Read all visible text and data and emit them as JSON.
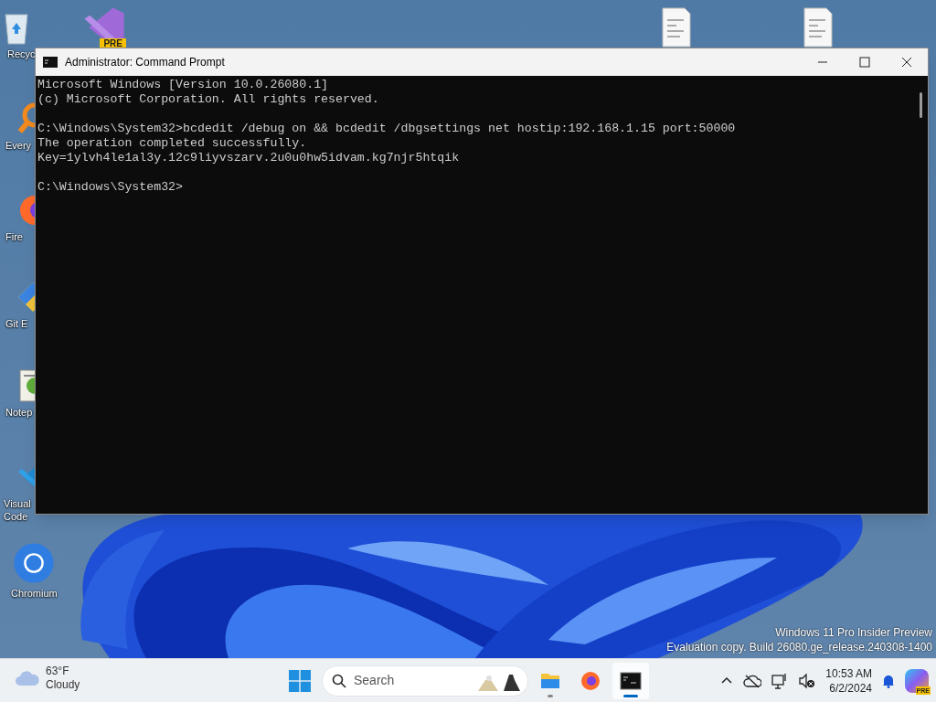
{
  "desktop": {
    "icons": [
      {
        "kind": "recycle",
        "label": "Recyc"
      },
      {
        "kind": "search",
        "label": "Every"
      },
      {
        "kind": "firefox",
        "label": "Fire"
      },
      {
        "kind": "git",
        "label": "Git E"
      },
      {
        "kind": "notepad",
        "label": "Notep"
      },
      {
        "kind": "vscode",
        "label": "Visual\nCode"
      },
      {
        "kind": "chromium",
        "label": "Chromium"
      },
      {
        "kind": "vs-preview",
        "badge": "PRE"
      },
      {
        "kind": "document"
      },
      {
        "kind": "document"
      }
    ],
    "watermark": [
      "Windows 11 Pro Insider Preview",
      "Evaluation copy. Build 26080.ge_release.240308-1400"
    ]
  },
  "window": {
    "title": "Administrator: Command Prompt",
    "focused": true,
    "lines": [
      {
        "kind": "text",
        "text": "Microsoft Windows [Version 10.0.26080.1]"
      },
      {
        "kind": "text",
        "text": "(c) Microsoft Corporation. All rights reserved."
      },
      {
        "kind": "blank"
      },
      {
        "kind": "text",
        "text": "C:\\Windows\\System32>bcdedit /debug on && bcdedit /dbgsettings net hostip:192.168.1.15 port:50000"
      },
      {
        "kind": "text",
        "text": "The operation completed successfully."
      },
      {
        "kind": "text",
        "text": "Key=1ylvh4le1al3y.12c9liyvszarv.2u0u0hw5idvam.kg7njr5htqik"
      },
      {
        "kind": "blank"
      },
      {
        "kind": "text",
        "text": "C:\\Windows\\System32>"
      }
    ]
  },
  "taskbar": {
    "weather": {
      "temperature": "63°F",
      "condition": "Cloudy"
    },
    "search": {
      "placeholder": "Search"
    },
    "apps": [
      {
        "kind": "explorer",
        "running": true,
        "selected": false
      },
      {
        "kind": "firefox",
        "running": false,
        "selected": false
      },
      {
        "kind": "terminal",
        "running": true,
        "selected": true
      }
    ],
    "clock": {
      "time": "10:53 AM",
      "date": "6/2/2024"
    },
    "copilot_badge": "PRE"
  }
}
